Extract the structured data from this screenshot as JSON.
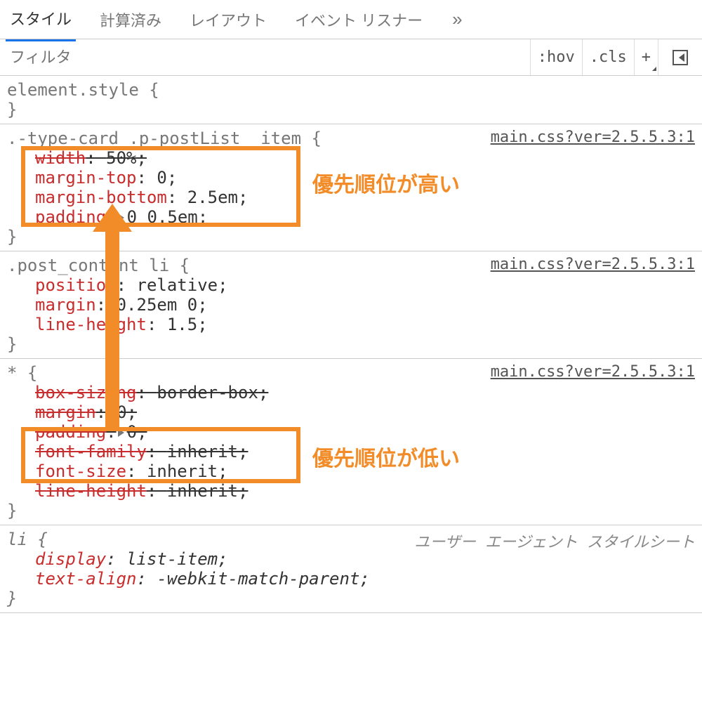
{
  "tabs": {
    "items": [
      "スタイル",
      "計算済み",
      "レイアウト",
      "イベント リスナー"
    ],
    "more": "»",
    "active_index": 0
  },
  "filter": {
    "placeholder": "フィルタ",
    "hov": ":hov",
    "cls": ".cls",
    "plus": "+"
  },
  "annotations": {
    "high": "優先順位が高い",
    "low": "優先順位が低い"
  },
  "rules": [
    {
      "selector": "element.style",
      "source": "",
      "decls": []
    },
    {
      "selector": ".-type-card .p-postList__item",
      "source": "main.css?ver=2.5.5.3:1",
      "decls": [
        {
          "prop": "width",
          "val": "50%",
          "strike": true
        },
        {
          "prop": "margin-top",
          "val": "0"
        },
        {
          "prop": "margin-bottom",
          "val": "2.5em"
        },
        {
          "prop": "padding",
          "val": "0 0.5em",
          "expand": true
        }
      ]
    },
    {
      "selector": ".post_content li",
      "source": "main.css?ver=2.5.5.3:1",
      "decls": [
        {
          "prop": "position",
          "val": "relative"
        },
        {
          "prop": "margin",
          "val": "0.25em 0"
        },
        {
          "prop": "line-height",
          "val": "1.5"
        }
      ]
    },
    {
      "selector": "*",
      "source": "main.css?ver=2.5.5.3:1",
      "decls": [
        {
          "prop": "box-sizing",
          "val": "border-box",
          "strike": true
        },
        {
          "prop": "margin",
          "val": "0",
          "strike": true,
          "expand": true
        },
        {
          "prop": "padding",
          "val": "0",
          "strike": true,
          "expand": true
        },
        {
          "prop": "font-family",
          "val": "inherit",
          "strike": true
        },
        {
          "prop": "font-size",
          "val": "inherit"
        },
        {
          "prop": "line-height",
          "val": "inherit",
          "strike": true
        }
      ]
    },
    {
      "selector": "li",
      "source": "ユーザー エージェント スタイルシート",
      "ua": true,
      "decls": [
        {
          "prop": "display",
          "val": "list-item",
          "italic": true
        },
        {
          "prop": "text-align",
          "val": "-webkit-match-parent",
          "italic": true
        }
      ]
    }
  ]
}
